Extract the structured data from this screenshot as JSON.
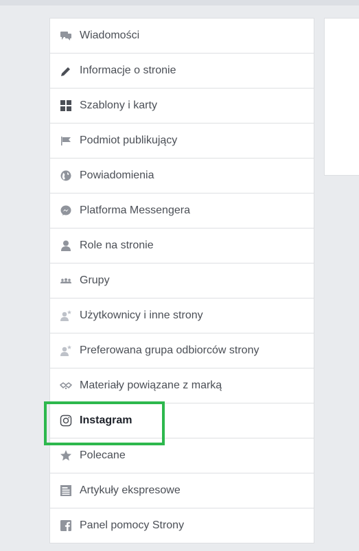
{
  "menu": {
    "items": [
      {
        "label": "Wiadomości",
        "icon": "messages-icon"
      },
      {
        "label": "Informacje o stronie",
        "icon": "pencil-icon"
      },
      {
        "label": "Szablony i karty",
        "icon": "grid-icon"
      },
      {
        "label": "Podmiot publikujący",
        "icon": "flag-icon"
      },
      {
        "label": "Powiadomienia",
        "icon": "globe-icon"
      },
      {
        "label": "Platforma Messengera",
        "icon": "messenger-icon"
      },
      {
        "label": "Role na stronie",
        "icon": "person-icon"
      },
      {
        "label": "Grupy",
        "icon": "groups-icon"
      },
      {
        "label": "Użytkownicy i inne strony",
        "icon": "person-star-icon"
      },
      {
        "label": "Preferowana grupa odbiorców strony",
        "icon": "person-star-icon"
      },
      {
        "label": "Materiały powiązane z marką",
        "icon": "handshake-icon"
      },
      {
        "label": "Instagram",
        "icon": "instagram-icon",
        "active": true
      },
      {
        "label": "Polecane",
        "icon": "star-icon"
      },
      {
        "label": "Artykuły ekspresowe",
        "icon": "article-icon"
      },
      {
        "label": "Panel pomocy Strony",
        "icon": "facebook-icon"
      }
    ]
  },
  "colors": {
    "highlight": "#2db84d",
    "icon": "#90949c",
    "text": "#4b4f56"
  }
}
